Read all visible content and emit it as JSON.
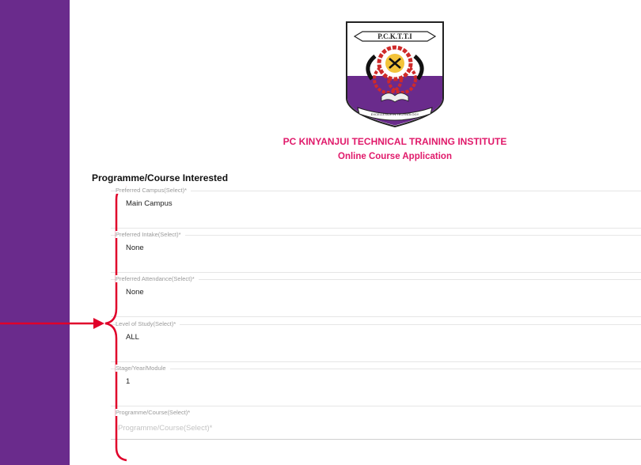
{
  "header": {
    "institute_name": "PC KINYANJUI TECHNICAL TRAINING INSTITUTE",
    "subtitle": "Online Course Application",
    "logo": {
      "banner_text": "P.C.K.T.T.I",
      "motto": "EXCELLENCE IN TECHNOLOGY"
    }
  },
  "section": {
    "title": "Programme/Course Interested"
  },
  "fields": [
    {
      "label": "Preferred Campus(Select)*",
      "value": "Main Campus"
    },
    {
      "label": "Preferred Intake(Select)*",
      "value": "None"
    },
    {
      "label": "Preferred Attendance(Select)*",
      "value": "None"
    },
    {
      "label": "Level of Study(Select)*",
      "value": "ALL"
    },
    {
      "label": "Stage/Year/Module",
      "value": "1"
    },
    {
      "label": "Programme/Course(Select)*",
      "placeholder": "Programme/Course(Select)*"
    }
  ],
  "colors": {
    "sidebar": "#6a2b8c",
    "accent": "#e0196a",
    "annotation": "#e0002a"
  }
}
